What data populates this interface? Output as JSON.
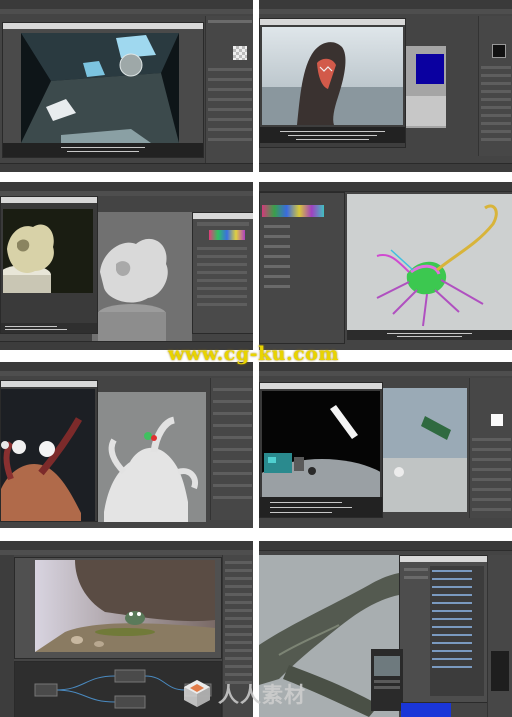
{
  "watermark": {
    "text": "www.cg-ku.com"
  },
  "logo": {
    "text": "人人素材",
    "mark": "cube-logo-icon"
  },
  "panels": [
    {
      "id": "1",
      "subject": "room-render"
    },
    {
      "id": "2",
      "subject": "seal-render"
    },
    {
      "id": "3",
      "subject": "sculpture-render"
    },
    {
      "id": "4",
      "subject": "creature-wireframe"
    },
    {
      "id": "5",
      "subject": "octopus-render"
    },
    {
      "id": "6",
      "subject": "robot-render"
    },
    {
      "id": "7",
      "subject": "crab-rock-render"
    },
    {
      "id": "8",
      "subject": "tree-branch-render"
    }
  ],
  "colors": {
    "ui_bg": "#444444",
    "ui_dark": "#2a2a2a",
    "watermark": "#e8d400",
    "accent_blue": "#0a00a0"
  }
}
